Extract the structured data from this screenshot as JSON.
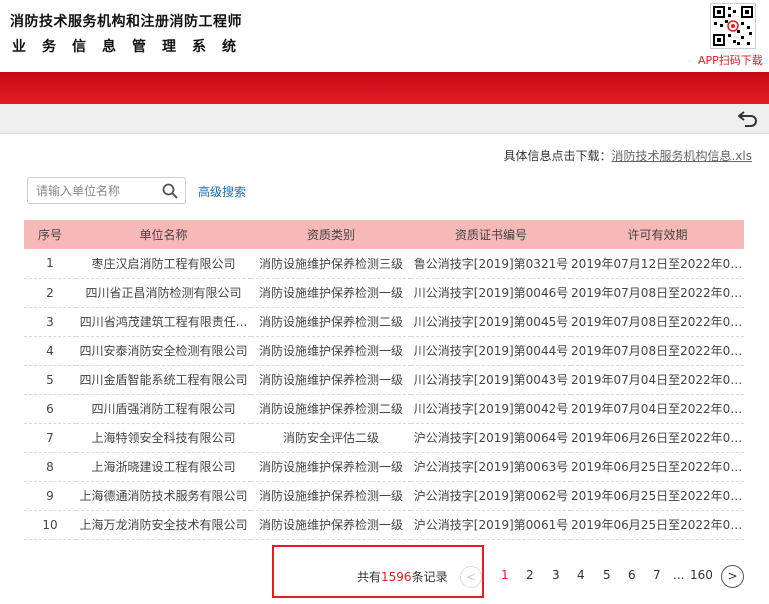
{
  "header": {
    "title_line1": "消防技术服务机构和注册消防工程师",
    "title_line2": "业务信息管理系统",
    "app_download": "APP扫码下载"
  },
  "download": {
    "prefix": "具体信息点击下载：",
    "file_link": "消防技术服务机构信息.xls"
  },
  "search": {
    "placeholder": "请输入单位名称",
    "advanced_label": "高级搜索"
  },
  "table": {
    "headers": [
      "序号",
      "单位名称",
      "资质类别",
      "资质证书编号",
      "许可有效期"
    ],
    "rows": [
      [
        "1",
        "枣庄汉启消防工程有限公司",
        "消防设施维护保养检测三级",
        "鲁公消技字[2019]第0321号",
        "2019年07月12日至2022年07..."
      ],
      [
        "2",
        "四川省正昌消防检测有限公司",
        "消防设施维护保养检测一级",
        "川公消技字[2019]第0046号",
        "2019年07月08日至2022年07..."
      ],
      [
        "3",
        "四川省鸿茂建筑工程有限责任...",
        "消防设施维护保养检测二级",
        "川公消技字[2019]第0045号",
        "2019年07月08日至2022年07..."
      ],
      [
        "4",
        "四川安泰消防安全检测有限公司",
        "消防设施维护保养检测一级",
        "川公消技字[2019]第0044号",
        "2019年07月08日至2022年07..."
      ],
      [
        "5",
        "四川金盾智能系统工程有限公司",
        "消防设施维护保养检测一级",
        "川公消技字[2019]第0043号",
        "2019年07月04日至2022年07..."
      ],
      [
        "6",
        "四川盾强消防工程有限公司",
        "消防设施维护保养检测二级",
        "川公消技字[2019]第0042号",
        "2019年07月04日至2022年07..."
      ],
      [
        "7",
        "上海特领安全科技有限公司",
        "消防安全评估二级",
        "沪公消技字[2019]第0064号",
        "2019年06月26日至2022年06..."
      ],
      [
        "8",
        "上海浙晓建设工程有限公司",
        "消防设施维护保养检测一级",
        "沪公消技字[2019]第0063号",
        "2019年06月25日至2022年06..."
      ],
      [
        "9",
        "上海德通消防技术服务有限公司",
        "消防设施维护保养检测一级",
        "沪公消技字[2019]第0062号",
        "2019年06月25日至2022年06..."
      ],
      [
        "10",
        "上海万龙消防安全技术有限公司",
        "消防设施维护保养检测一级",
        "沪公消技字[2019]第0061号",
        "2019年06月25日至2022年06..."
      ]
    ]
  },
  "pagination": {
    "total_prefix": "共有",
    "total_count": "1596",
    "total_suffix": "条记录",
    "prev": "<",
    "pages": [
      "1",
      "2",
      "3",
      "4",
      "5",
      "6",
      "7"
    ],
    "current": "1",
    "ellipsis": "...",
    "last": "160",
    "next": ">"
  },
  "colors": {
    "brand_red": "#e31d25",
    "header_row_pink": "#f7b8b8",
    "link_blue": "#1d6fc4",
    "highlight_red": "#e51e1e"
  }
}
